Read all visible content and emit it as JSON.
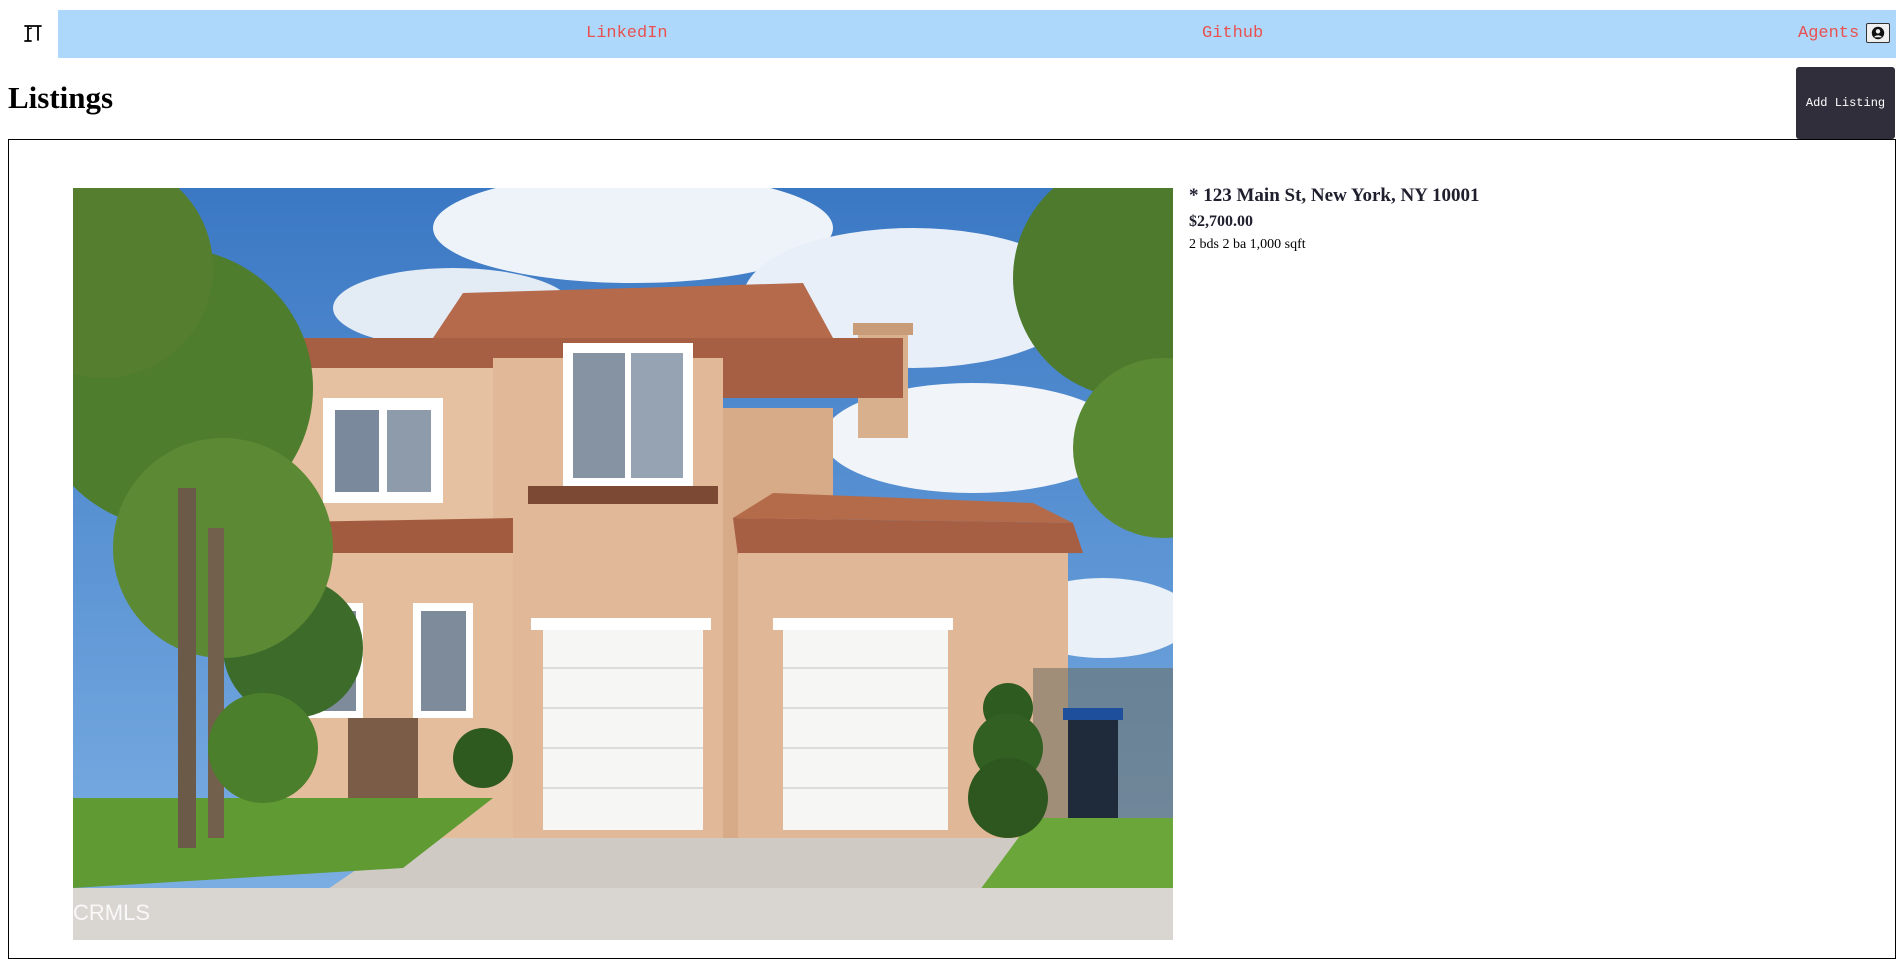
{
  "header": {
    "logo_icon": "door-logo-icon",
    "nav": {
      "linkedin_label": "LinkedIn",
      "github_label": "Github",
      "agents_label": "Agents"
    },
    "account_icon": "user-circle-icon",
    "nav_background": "#add8fb",
    "link_color": "#e8514f"
  },
  "main": {
    "title": "Listings",
    "add_listing_label": "Add Listing",
    "add_listing_color": "#2f2e3a"
  },
  "listings": [
    {
      "address": "* 123 Main St, New York, NY 10001",
      "price": "$2,700.00",
      "details": "2 bds 2 ba 1,000 sqft",
      "photo_watermark": "CRMLS"
    }
  ]
}
